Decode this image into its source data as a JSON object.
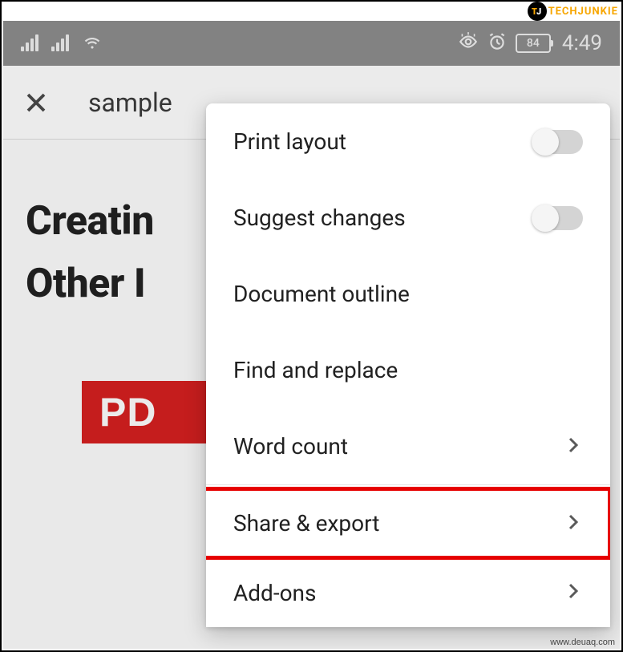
{
  "watermark": {
    "top_text": "TECHJUNKIE",
    "bottom_text": "www.deuaq.com"
  },
  "statusbar": {
    "battery": "84",
    "time": "4:49"
  },
  "appbar": {
    "title": "sample"
  },
  "document": {
    "headline_line1": "Creatin",
    "headline_line2": "Other I",
    "pdf_badge": "PD"
  },
  "menu": {
    "items": [
      {
        "label": "Print layout",
        "type": "toggle",
        "on": false
      },
      {
        "label": "Suggest changes",
        "type": "toggle",
        "on": false
      },
      {
        "label": "Document outline",
        "type": "plain"
      },
      {
        "label": "Find and replace",
        "type": "plain"
      },
      {
        "label": "Word count",
        "type": "nav"
      },
      {
        "label": "Share & export",
        "type": "nav",
        "highlighted": true
      },
      {
        "label": "Add-ons",
        "type": "nav"
      }
    ]
  }
}
